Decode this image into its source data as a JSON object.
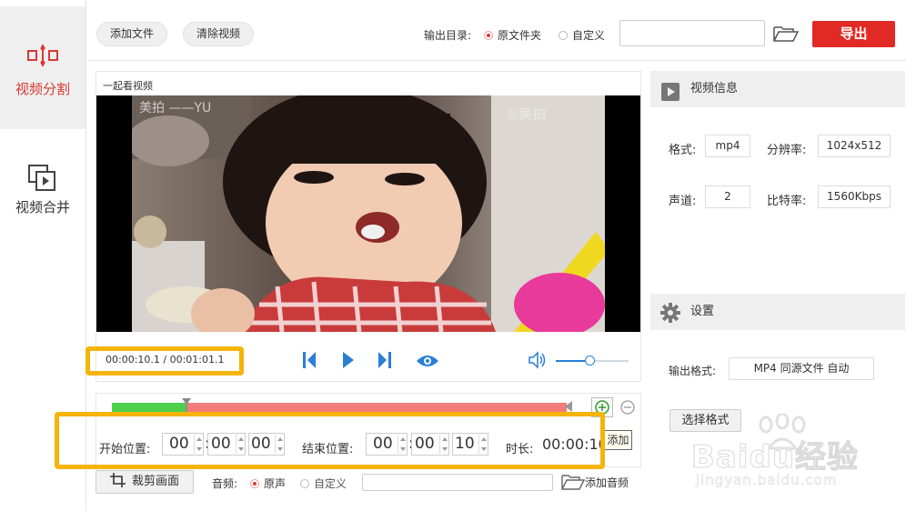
{
  "sidebar": {
    "split_label": "视频分割",
    "merge_label": "视频合并"
  },
  "toolbar": {
    "add_file": "添加文件",
    "clear_video": "清除视频",
    "output_dir_label": "输出目录:",
    "option_source": "原文件夹",
    "option_custom": "自定义",
    "export": "导出"
  },
  "player": {
    "title": "一起看视频",
    "time": "00:00:10.1 / 00:01:01.1",
    "watermark_left": "美拍 ——YU",
    "watermark_right": "◎美拍"
  },
  "trim": {
    "start_label": "开始位置:",
    "start": [
      "00",
      "00",
      "00"
    ],
    "end_label": "结束位置:",
    "end": [
      "00",
      "00",
      "10"
    ],
    "duration_label": "时长:",
    "duration": "00:00:10",
    "tooltip": "添加"
  },
  "bottom": {
    "crop": "裁剪画面",
    "audio_label": "音频:",
    "audio_original": "原声",
    "audio_custom": "自定义",
    "add_audio": "添加音频"
  },
  "video_info": {
    "title": "视频信息",
    "format_label": "格式:",
    "format": "mp4",
    "resolution_label": "分辨率:",
    "resolution": "1024x512",
    "channel_label": "声道:",
    "channel": "2",
    "bitrate_label": "比特率:",
    "bitrate": "1560Kbps"
  },
  "settings": {
    "title": "设置",
    "output_format_label": "输出格式:",
    "output_format": "MP4 同源文件 自动",
    "choose_format": "选择格式"
  },
  "watermark": {
    "brand": "Baidu经验",
    "url": "jingyan.baidu.com"
  },
  "colors": {
    "accent": "#e12a26",
    "blue": "#2a7fd4",
    "highlight": "#f5b40a",
    "range_red": "#f27c79",
    "range_green": "#4cd04c"
  }
}
